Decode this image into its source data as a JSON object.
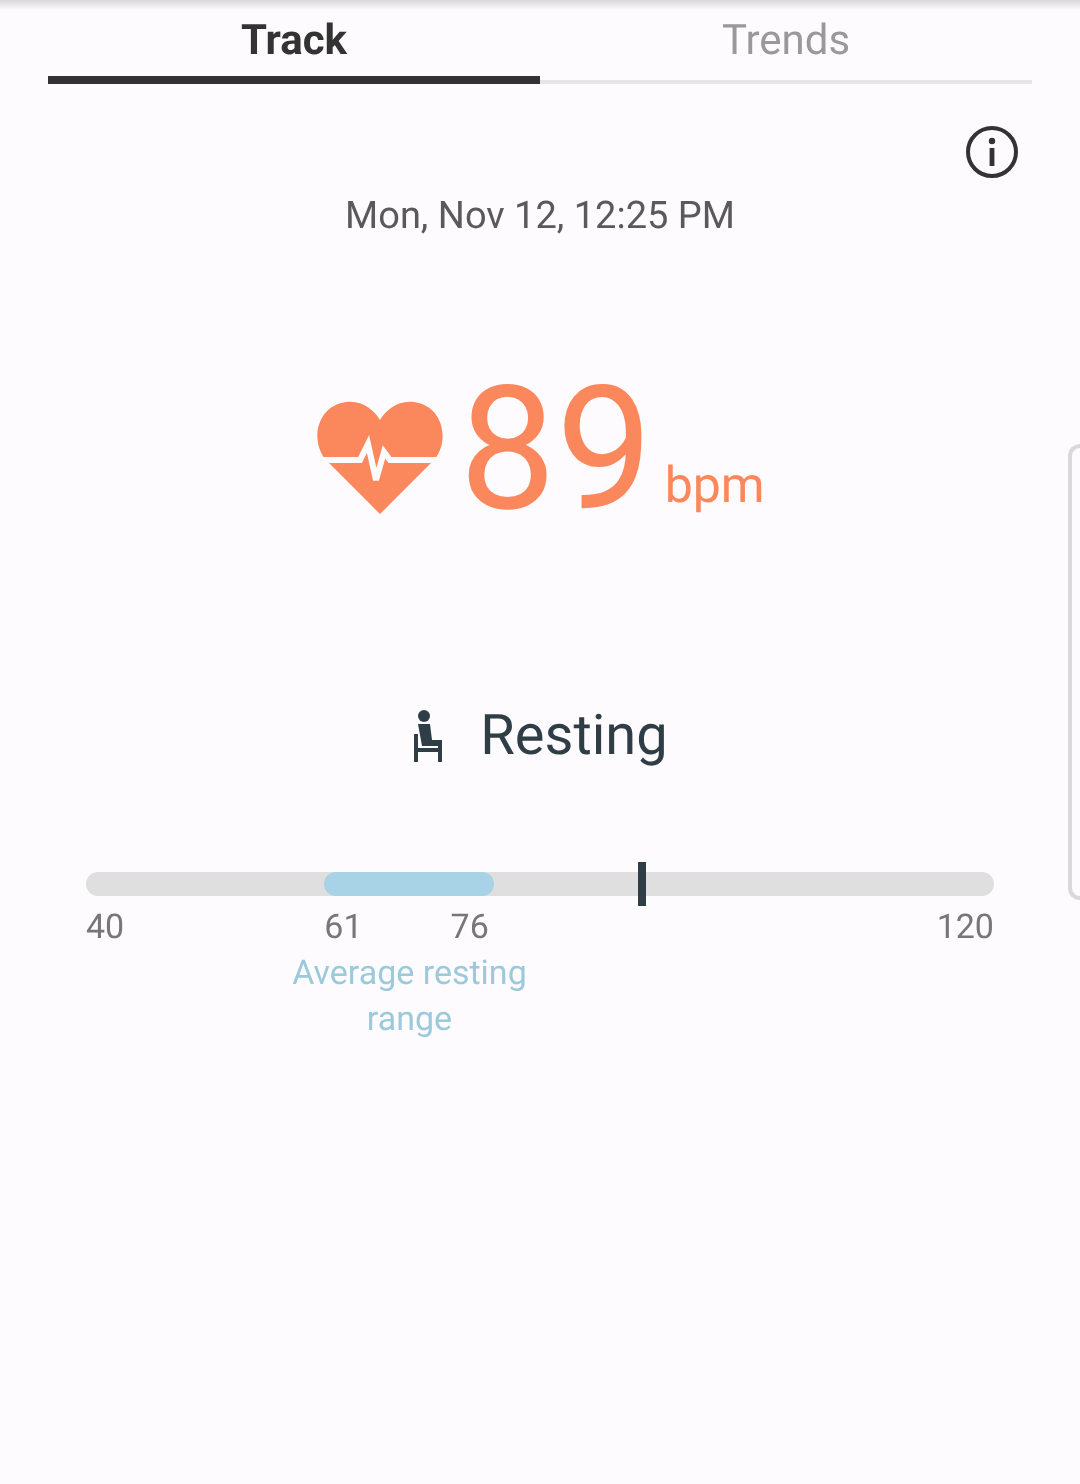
{
  "tabs": [
    {
      "label": "Track",
      "selected": true
    },
    {
      "label": "Trends",
      "selected": false
    }
  ],
  "timestamp": "Mon, Nov 12, 12:25 PM",
  "reading": {
    "value": "89",
    "unit": "bpm"
  },
  "state": {
    "label": "Resting"
  },
  "range_bar": {
    "min": "40",
    "max": "120",
    "range_low": "61",
    "range_high": "76",
    "range_caption": "Average resting range",
    "level": 0.6125
  }
}
